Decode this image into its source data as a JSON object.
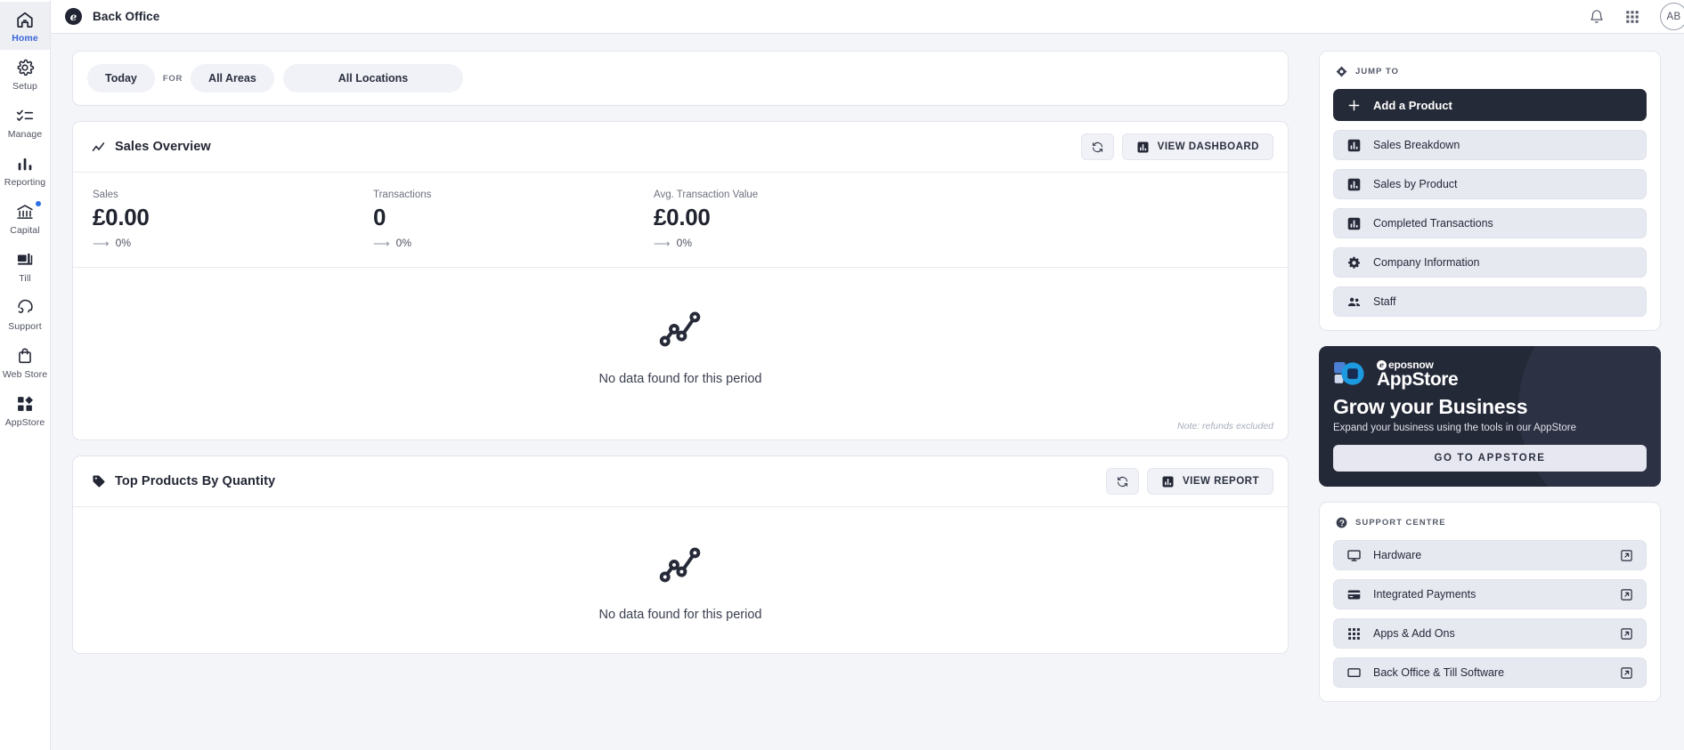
{
  "rail": {
    "items": [
      {
        "label": "Home",
        "icon": "home-icon",
        "active": true,
        "badge": false
      },
      {
        "label": "Setup",
        "icon": "gear-icon",
        "active": false,
        "badge": false
      },
      {
        "label": "Manage",
        "icon": "checklist-icon",
        "active": false,
        "badge": false
      },
      {
        "label": "Reporting",
        "icon": "bar-chart-icon",
        "active": false,
        "badge": false
      },
      {
        "label": "Capital",
        "icon": "bank-icon",
        "active": false,
        "badge": true
      },
      {
        "label": "Till",
        "icon": "till-icon",
        "active": false,
        "badge": false
      },
      {
        "label": "Support",
        "icon": "headset-icon",
        "active": false,
        "badge": false
      },
      {
        "label": "Web Store",
        "icon": "bag-icon",
        "active": false,
        "badge": false
      },
      {
        "label": "AppStore",
        "icon": "apps-icon",
        "active": false,
        "badge": false
      }
    ]
  },
  "topbar": {
    "brand_mark": "e",
    "title": "Back Office",
    "notifications_icon": "bell-icon",
    "apps_icon": "grid-apps-icon",
    "avatar_initials": "AB"
  },
  "filters": {
    "period": "Today",
    "for_label": "FOR",
    "area": "All Areas",
    "location": "All Locations"
  },
  "sales_overview": {
    "title": "Sales Overview",
    "icon": "line-chart-icon",
    "refresh_icon": "refresh-icon",
    "action_label": "VIEW DASHBOARD",
    "action_icon": "bar-chart-icon",
    "kpis": [
      {
        "label": "Sales",
        "value": "£0.00",
        "delta": "0%",
        "trend": "flat"
      },
      {
        "label": "Transactions",
        "value": "0",
        "delta": "0%",
        "trend": "flat"
      },
      {
        "label": "Avg. Transaction Value",
        "value": "£0.00",
        "delta": "0%",
        "trend": "flat"
      }
    ],
    "empty_message": "No data found for this period",
    "empty_icon": "line-chart-icon",
    "note": "Note: refunds excluded"
  },
  "top_products": {
    "title": "Top Products By Quantity",
    "icon": "tag-icon",
    "refresh_icon": "refresh-icon",
    "action_label": "VIEW REPORT",
    "action_icon": "bar-chart-icon",
    "empty_message": "No data found for this period",
    "empty_icon": "line-chart-icon"
  },
  "jump_to": {
    "heading": "JUMP TO",
    "heading_icon": "jump-icon",
    "primary": {
      "label": "Add a Product",
      "icon": "plus-icon"
    },
    "items": [
      {
        "label": "Sales Breakdown",
        "icon": "bar-chart-icon"
      },
      {
        "label": "Sales by Product",
        "icon": "bar-chart-icon"
      },
      {
        "label": "Completed Transactions",
        "icon": "bar-chart-icon"
      },
      {
        "label": "Company Information",
        "icon": "gear-icon"
      },
      {
        "label": "Staff",
        "icon": "people-icon"
      }
    ]
  },
  "promo": {
    "brand": "eposnow",
    "brand_mark": "e",
    "product": "AppStore",
    "headline": "Grow your Business",
    "subtext": "Expand your business using the tools in our AppStore",
    "button_label": "GO TO APPSTORE",
    "background": "#242938"
  },
  "support_centre": {
    "heading": "SUPPORT CENTRE",
    "heading_icon": "help-icon",
    "items": [
      {
        "label": "Hardware",
        "icon": "monitor-icon",
        "external_icon": "external-link-icon"
      },
      {
        "label": "Integrated Payments",
        "icon": "card-icon",
        "external_icon": "external-link-icon"
      },
      {
        "label": "Apps & Add Ons",
        "icon": "grid-apps-icon",
        "external_icon": "external-link-icon"
      },
      {
        "label": "Back Office & Till Software",
        "icon": "screen-icon",
        "external_icon": "external-link-icon"
      }
    ]
  },
  "colors": {
    "accent": "#3a66d8",
    "dark": "#252a38",
    "page_bg": "#f4f5f9",
    "row_bg": "#e7e9f1",
    "badge": "#2f6fe4"
  }
}
